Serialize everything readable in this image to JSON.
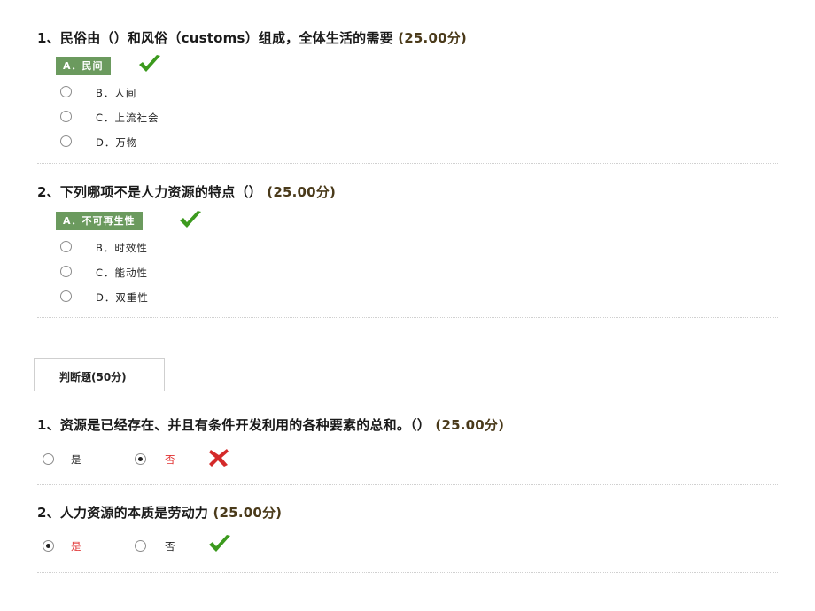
{
  "multiple_choice": [
    {
      "title": "1、民俗由（）和风俗（customs）组成，全体生活的需要",
      "score": "(25.00分)",
      "correct_option": "A．民间",
      "result_icon": "check-icon",
      "options": [
        "B．人间",
        "C．上流社会",
        "D．万物"
      ]
    },
    {
      "title": "2、下列哪项不是人力资源的特点（）",
      "score": "(25.00分)",
      "correct_option": "A．不可再生性",
      "result_icon": "check-icon",
      "options": [
        "B．时效性",
        "C．能动性",
        "D．双重性"
      ]
    }
  ],
  "section_tab": {
    "label": "判断题(50分)"
  },
  "true_false": [
    {
      "title": "1、资源是已经存在、并且有条件开发利用的各种要素的总和。（）",
      "score": "(25.00分)",
      "options": [
        {
          "label": "是",
          "selected": false
        },
        {
          "label": "否",
          "selected": true
        }
      ],
      "result_icon": "cross-icon"
    },
    {
      "title": "2、人力资源的本质是劳动力",
      "score": "(25.00分)",
      "options": [
        {
          "label": "是",
          "selected": true
        },
        {
          "label": "否",
          "selected": false
        }
      ],
      "result_icon": "check-icon"
    }
  ],
  "colors": {
    "correct_bg": "#6b9a5e",
    "check": "#3c9a1e",
    "cross": "#d42a2a",
    "selected_text": "#e03030"
  }
}
